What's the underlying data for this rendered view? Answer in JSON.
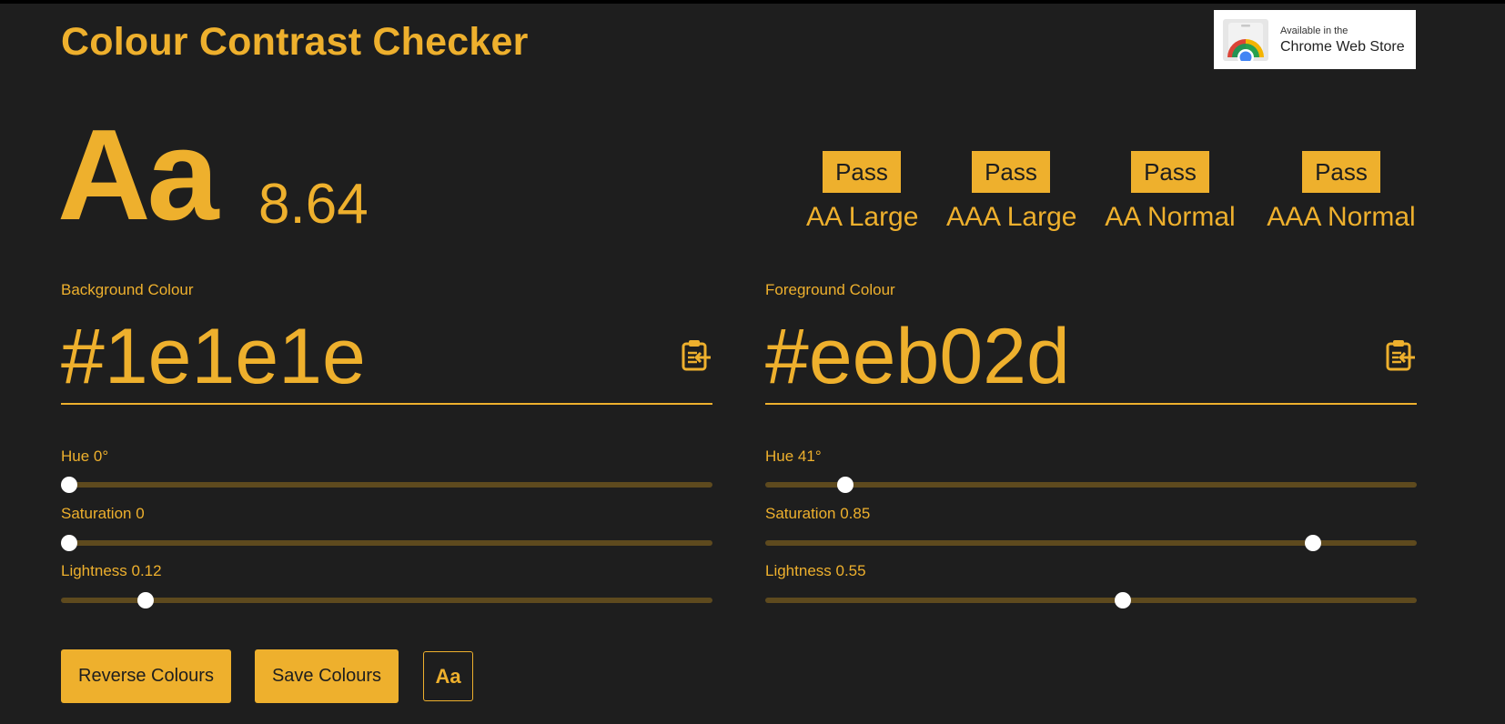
{
  "header": {
    "title": "Colour Contrast Checker"
  },
  "store_badge": {
    "line1": "Available in the",
    "line2": "Chrome Web Store",
    "icon": "chrome-web-store-icon"
  },
  "preview": {
    "sample": "Aa",
    "ratio": "8.64"
  },
  "results": [
    {
      "status": "Pass",
      "level": "AA Large"
    },
    {
      "status": "Pass",
      "level": "AAA Large"
    },
    {
      "status": "Pass",
      "level": "AA Normal"
    },
    {
      "status": "Pass",
      "level": "AAA Normal"
    }
  ],
  "background": {
    "label": "Background Colour",
    "hex": "#1e1e1e",
    "paste_icon": "clipboard-paste-icon",
    "hue": {
      "label": "Hue 0°",
      "value": 0,
      "max": 360
    },
    "saturation": {
      "label": "Saturation 0",
      "value": 0,
      "max": 1
    },
    "lightness": {
      "label": "Lightness 0.12",
      "value": 0.12,
      "max": 1
    }
  },
  "foreground": {
    "label": "Foreground Colour",
    "hex": "#eeb02d",
    "paste_icon": "clipboard-paste-icon",
    "hue": {
      "label": "Hue 41°",
      "value": 41,
      "max": 360
    },
    "saturation": {
      "label": "Saturation 0.85",
      "value": 0.85,
      "max": 1
    },
    "lightness": {
      "label": "Lightness 0.55",
      "value": 0.55,
      "max": 1
    }
  },
  "actions": {
    "reverse_label": "Reverse Colours",
    "save_label": "Save Colours",
    "font_toggle_label": "Aa"
  },
  "colors": {
    "background": "#1e1e1e",
    "accent": "#eeb02d",
    "track": "#5e4a1e",
    "thumb": "#ffffff"
  }
}
